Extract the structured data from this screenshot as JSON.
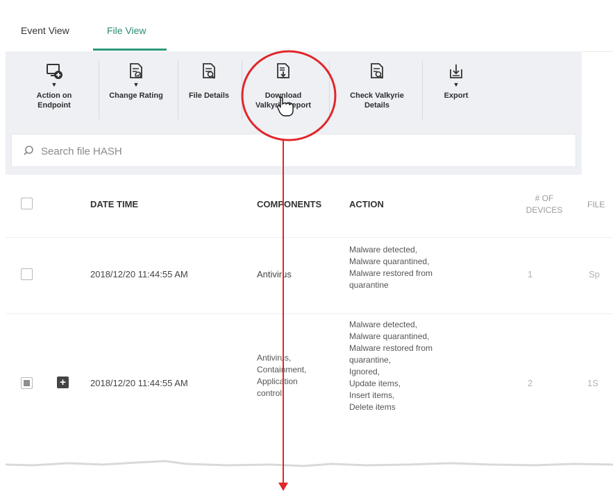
{
  "tabs": [
    {
      "label": "Event View"
    },
    {
      "label": "File View"
    }
  ],
  "toolbar": {
    "items": [
      {
        "label_lines": [
          "Action on",
          "Endpoint"
        ],
        "icon": "endpoint-add-icon",
        "has_dropdown": true
      },
      {
        "label_lines": [
          "Change Rating"
        ],
        "icon": "rating-document-icon",
        "has_dropdown": true
      },
      {
        "label_lines": [
          "File Details"
        ],
        "icon": "file-details-icon",
        "has_dropdown": false
      },
      {
        "label_lines": [
          "Download",
          "Valkyrie Report"
        ],
        "icon": "download-report-icon",
        "has_dropdown": false
      },
      {
        "label_lines": [
          "Check Valkyrie",
          "Details"
        ],
        "icon": "check-details-icon",
        "has_dropdown": false
      },
      {
        "label_lines": [
          "Export"
        ],
        "icon": "export-icon",
        "has_dropdown": true
      }
    ]
  },
  "search": {
    "placeholder": "Search file HASH",
    "value": ""
  },
  "table": {
    "columns": [
      "DATE TIME",
      "COMPONENTS",
      "ACTION",
      "# OF DEVICES",
      "FILE"
    ],
    "rows": [
      {
        "date_time": "2018/12/20 11:44:55 AM",
        "components": [
          "Antivirus"
        ],
        "action": [
          "Malware detected,",
          "Malware quarantined,",
          "Malware restored from",
          "quarantine"
        ],
        "devices": "1",
        "file": "Sp",
        "checked": false,
        "expandable": false
      },
      {
        "date_time": "2018/12/20 11:44:55 AM",
        "components": [
          "Antivirus,",
          "Containment,",
          "Application",
          "control"
        ],
        "action": [
          "Malware detected,",
          "Malware quarantined,",
          "Malware restored from",
          "quarantine,",
          "Ignored,",
          "Update items,",
          "Insert items,",
          "Delete items"
        ],
        "devices": "2",
        "file": "1S",
        "checked": "indeterminate",
        "expandable": true
      }
    ]
  },
  "colors": {
    "accent": "#2a9a78",
    "annotation": "#e0262a",
    "toolbar_bg": "#eef0f4"
  }
}
